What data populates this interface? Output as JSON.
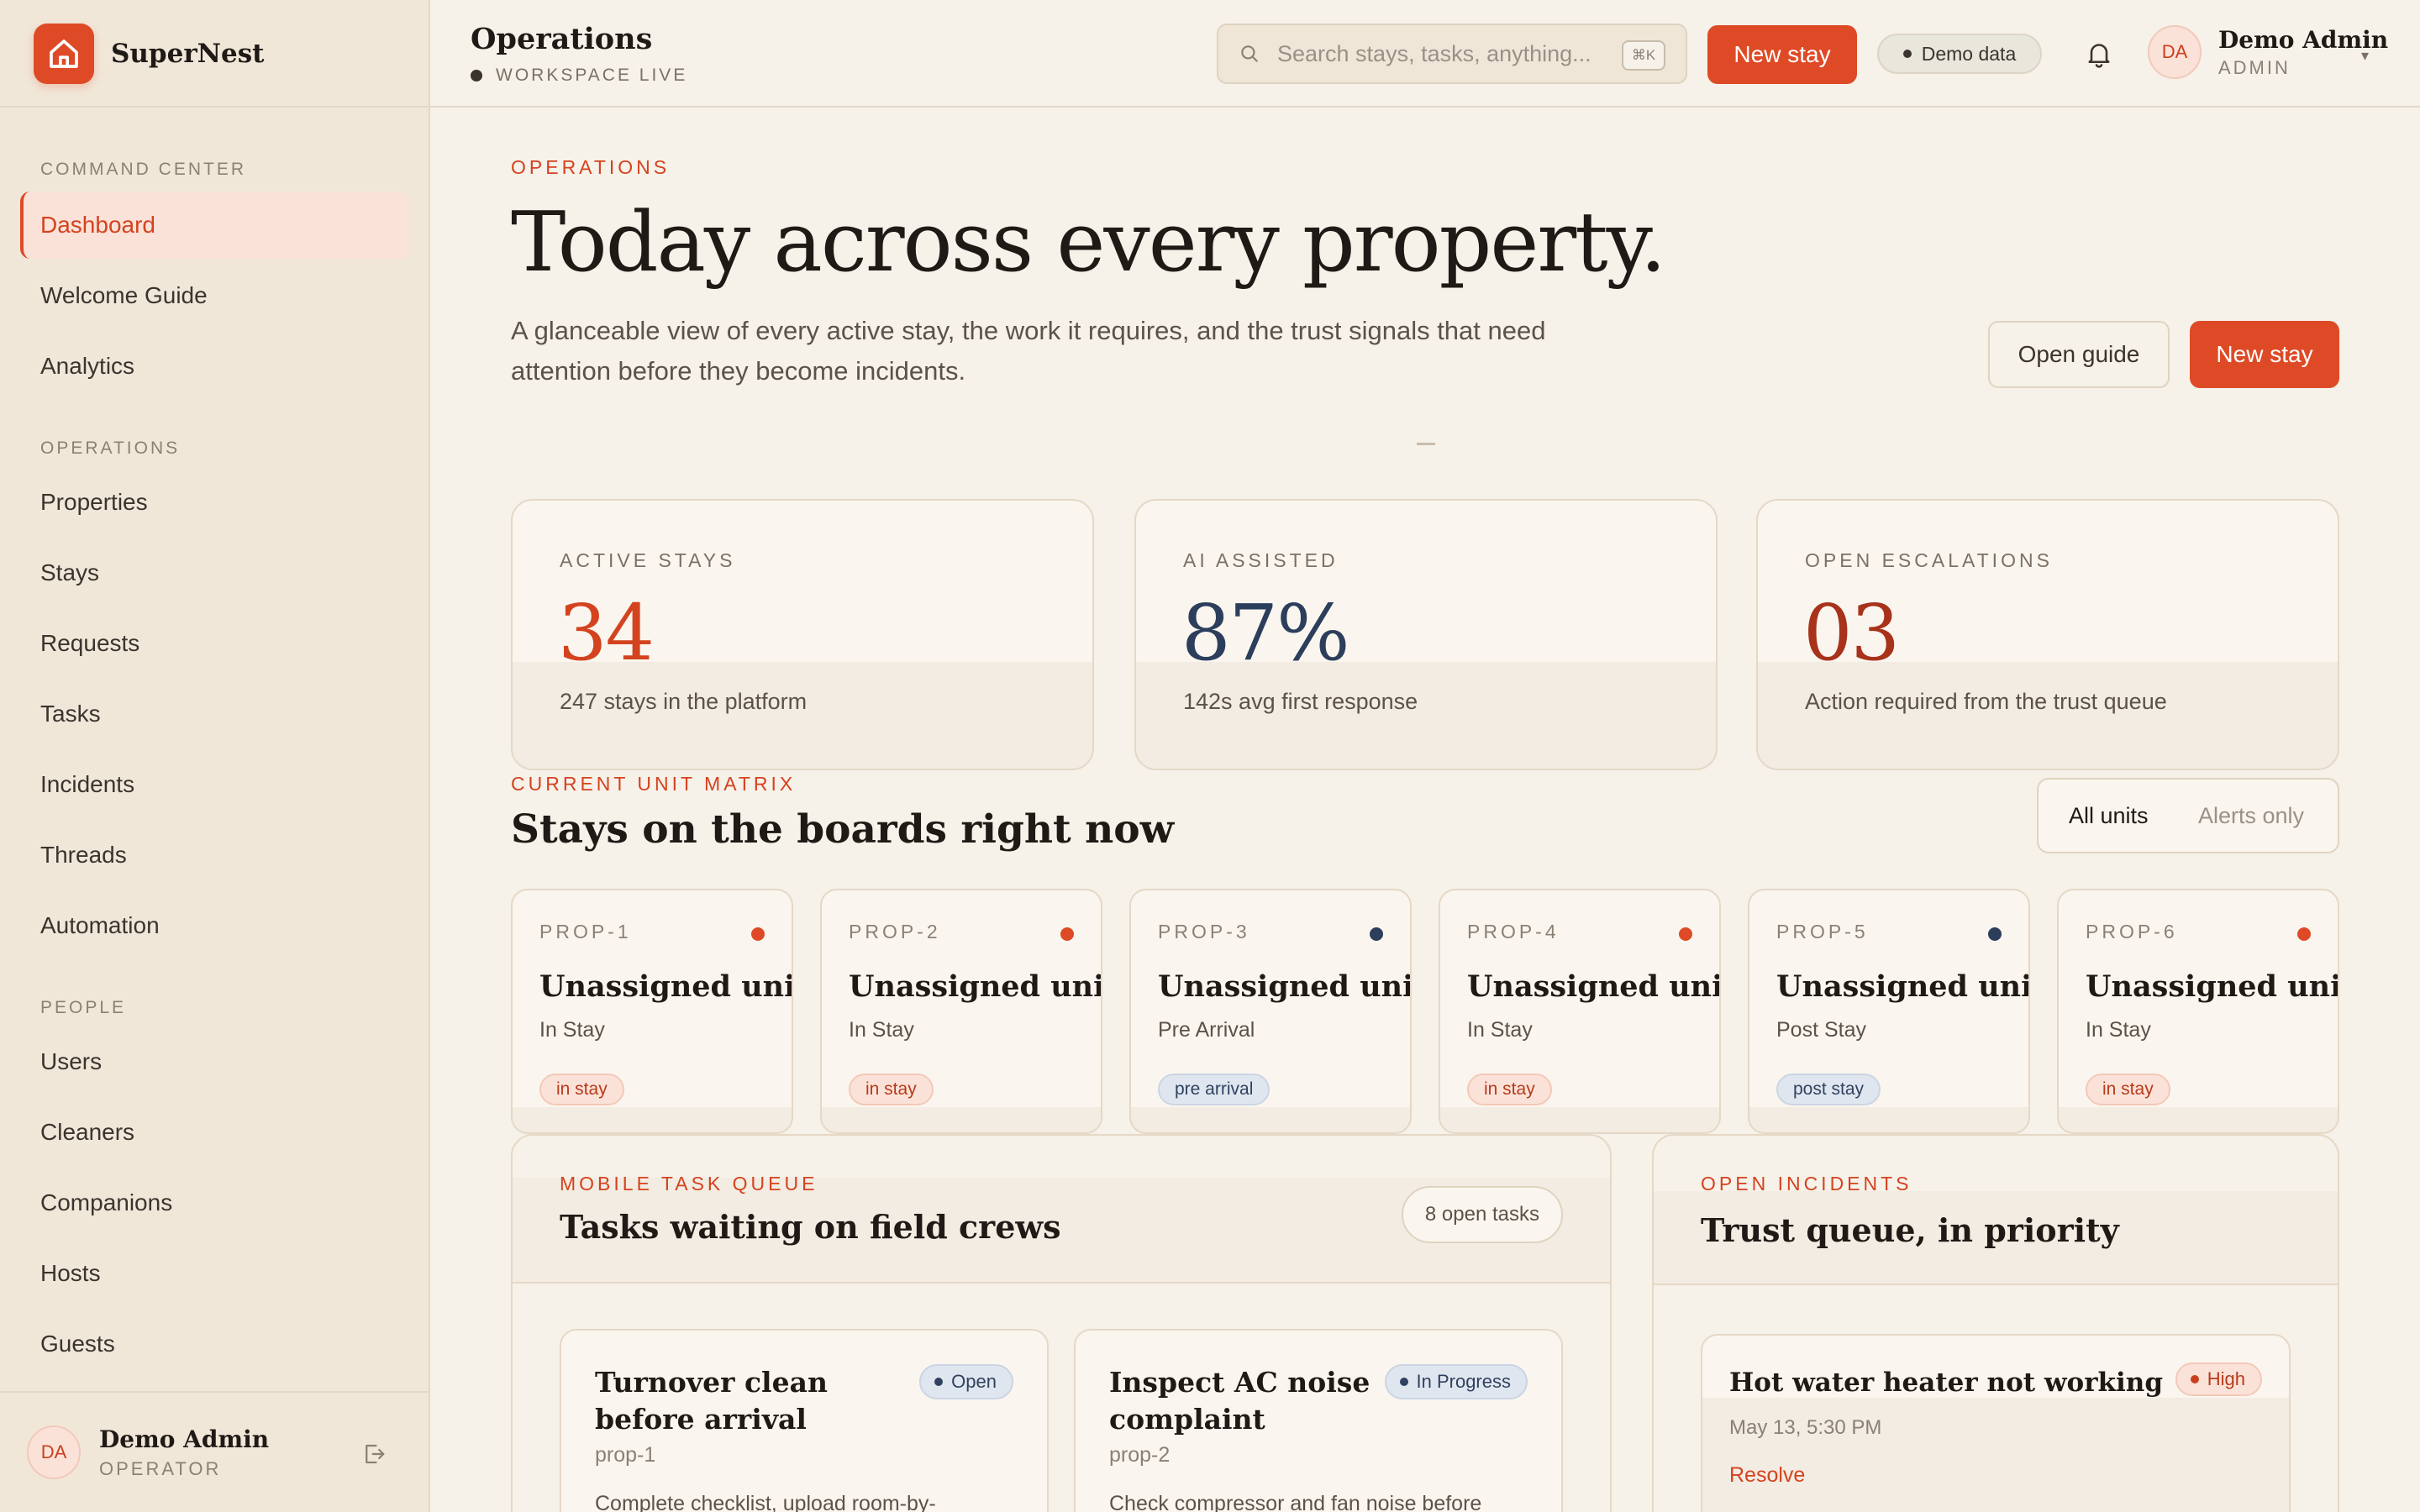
{
  "brand": {
    "name": "SuperNest"
  },
  "sidebar": {
    "sections": [
      {
        "title": "COMMAND CENTER",
        "items": [
          "Dashboard",
          "Welcome Guide",
          "Analytics"
        ]
      },
      {
        "title": "OPERATIONS",
        "items": [
          "Properties",
          "Stays",
          "Requests",
          "Tasks",
          "Incidents",
          "Threads",
          "Automation"
        ]
      },
      {
        "title": "PEOPLE",
        "items": [
          "Users",
          "Cleaners",
          "Companions",
          "Hosts",
          "Guests"
        ]
      }
    ],
    "active_item": "Dashboard",
    "user": {
      "initials": "DA",
      "name": "Demo Admin",
      "role": "OPERATOR"
    }
  },
  "topbar": {
    "title": "Operations",
    "status": "WORKSPACE LIVE",
    "search_placeholder": "Search stays, tasks, anything...",
    "search_shortcut": "⌘K",
    "new_stay_label": "New stay",
    "demo_label": "Demo data",
    "user": {
      "initials": "DA",
      "name": "Demo Admin",
      "role": "ADMIN"
    }
  },
  "hero": {
    "eyebrow": "OPERATIONS",
    "title": "Today across every property.",
    "subtitle": "A glanceable view of every active stay, the work it requires, and the trust signals that need attention before they become incidents.",
    "open_guide_label": "Open guide",
    "new_stay_label": "New stay"
  },
  "stats": [
    {
      "label": "ACTIVE STAYS",
      "value": "34",
      "caption": "247 stays in the platform",
      "color": "#d4431f"
    },
    {
      "label": "AI ASSISTED",
      "value": "87%",
      "caption": "142s avg first response",
      "color": "#2c3e5c"
    },
    {
      "label": "OPEN ESCALATIONS",
      "value": "03",
      "caption": "Action required from the trust queue",
      "color": "#a8321a"
    }
  ],
  "matrix": {
    "eyebrow": "CURRENT UNIT MATRIX",
    "title": "Stays on the boards right now",
    "filters": [
      "All units",
      "Alerts only"
    ],
    "active_filter": "All units",
    "units": [
      {
        "code": "PROP-1",
        "name": "Unassigned unit",
        "status": "In Stay",
        "badge": "in stay",
        "kind": "instay",
        "dot": "#de4a26"
      },
      {
        "code": "PROP-2",
        "name": "Unassigned unit",
        "status": "In Stay",
        "badge": "in stay",
        "kind": "instay",
        "dot": "#de4a26"
      },
      {
        "code": "PROP-3",
        "name": "Unassigned unit",
        "status": "Pre Arrival",
        "badge": "pre arrival",
        "kind": "pre",
        "dot": "#2c3e5c"
      },
      {
        "code": "PROP-4",
        "name": "Unassigned unit",
        "status": "In Stay",
        "badge": "in stay",
        "kind": "instay",
        "dot": "#de4a26"
      },
      {
        "code": "PROP-5",
        "name": "Unassigned unit",
        "status": "Post Stay",
        "badge": "post stay",
        "kind": "post",
        "dot": "#2c3e5c"
      },
      {
        "code": "PROP-6",
        "name": "Unassigned unit",
        "status": "In Stay",
        "badge": "in stay",
        "kind": "instay",
        "dot": "#de4a26"
      }
    ]
  },
  "tasks": {
    "eyebrow": "MOBILE TASK QUEUE",
    "title": "Tasks waiting on field crews",
    "count_label": "8 open tasks",
    "items": [
      {
        "title": "Turnover clean before arrival",
        "property": "prop-1",
        "status": "Open",
        "description": "Complete checklist, upload room-by-"
      },
      {
        "title": "Inspect AC noise complaint",
        "property": "prop-2",
        "status": "In Progress",
        "description": "Check compressor and fan noise before"
      }
    ]
  },
  "incidents": {
    "eyebrow": "OPEN INCIDENTS",
    "title": "Trust queue, in priority",
    "items": [
      {
        "title": "Hot water heater not working",
        "priority": "High",
        "time": "May 13, 5:30 PM",
        "action": "Resolve"
      }
    ]
  }
}
